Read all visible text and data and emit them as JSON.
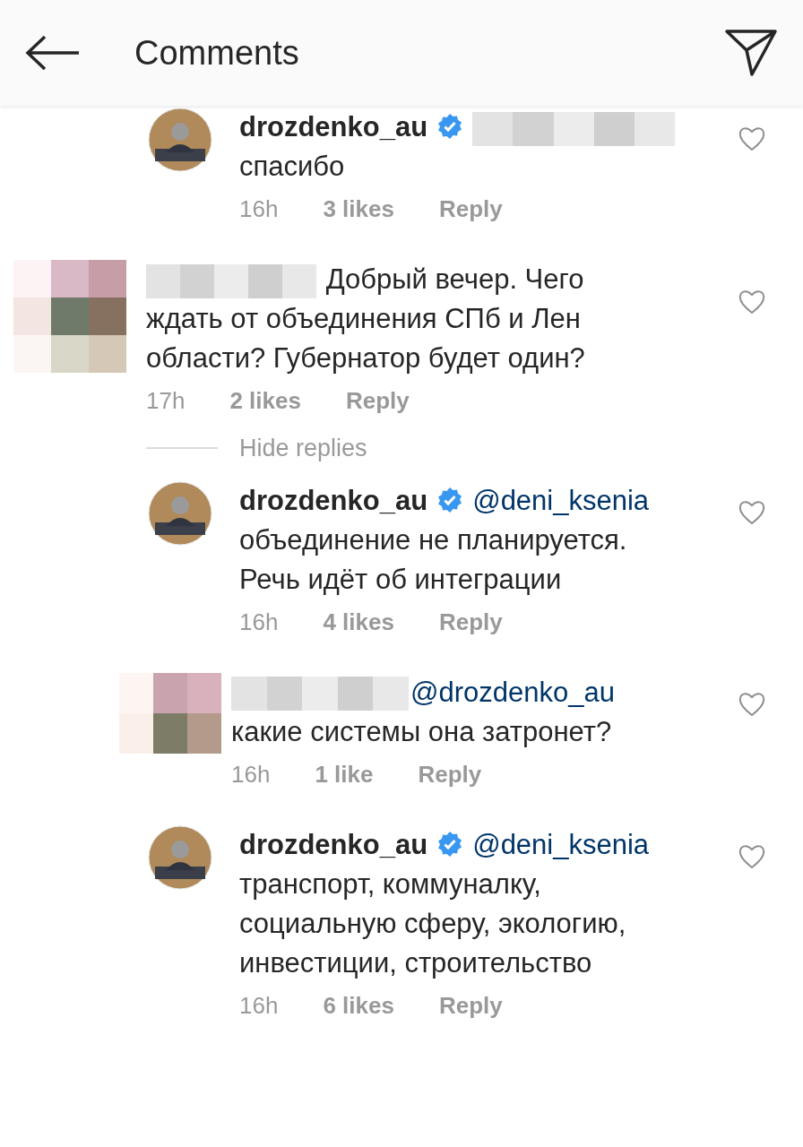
{
  "header": {
    "title": "Comments"
  },
  "items": [
    {
      "kind": "reply",
      "username": "drozdenko_au",
      "verified": true,
      "redacted_user": false,
      "redacted_mention": true,
      "text": "спасибо",
      "time": "16h",
      "likes": "3 likes",
      "reply": "Reply",
      "liked": false
    },
    {
      "kind": "comment",
      "verified": false,
      "redacted_user": true,
      "redacted_mention": false,
      "text": "Добрый вечер. Чего ждать от объединения СПб и Лен области? Губернатор будет один?",
      "time": "17h",
      "likes": "2 likes",
      "reply": "Reply",
      "liked": false
    },
    {
      "kind": "toggle",
      "label": "Hide replies"
    },
    {
      "kind": "reply",
      "username": "drozdenko_au",
      "verified": true,
      "redacted_user": false,
      "redacted_mention": false,
      "mention": "@deni_ksenia",
      "text": "объединение не планируется. Речь идёт об интеграции",
      "time": "16h",
      "likes": "4 likes",
      "reply": "Reply",
      "liked": false
    },
    {
      "kind": "reply",
      "verified": false,
      "redacted_user": true,
      "redacted_mention": false,
      "mention": "@drozdenko_au",
      "text": "какие системы она затронет?",
      "time": "16h",
      "likes": "1 like",
      "reply": "Reply",
      "liked": false
    },
    {
      "kind": "reply",
      "username": "drozdenko_au",
      "verified": true,
      "redacted_user": false,
      "redacted_mention": false,
      "mention": "@deni_ksenia",
      "text": "транспорт, коммуналку, социальную сферу, экологию, инвестиции, строительство",
      "time": "16h",
      "likes": "6 likes",
      "reply": "Reply",
      "liked": false
    }
  ]
}
